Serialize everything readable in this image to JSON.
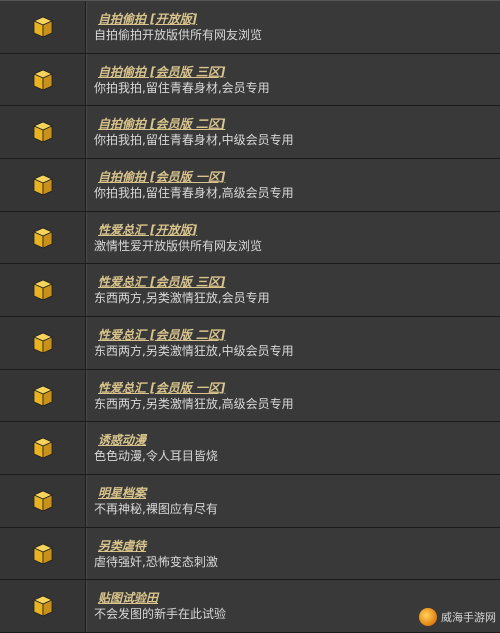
{
  "forums": [
    {
      "title": "自拍偷拍 [开放版]",
      "desc": "自拍偷拍开放版供所有网友浏览"
    },
    {
      "title": "自拍偷拍 [会员版 三区]",
      "desc": "你拍我拍,留住青春身材,会员专用"
    },
    {
      "title": "自拍偷拍 [会员版 二区]",
      "desc": "你拍我拍,留住青春身材,中级会员专用"
    },
    {
      "title": "自拍偷拍 [会员版 一区]",
      "desc": "你拍我拍,留住青春身材,高级会员专用"
    },
    {
      "title": "性爱总汇 [开放版]",
      "desc": "激情性爱开放版供所有网友浏览"
    },
    {
      "title": "性爱总汇 [会员版 三区]",
      "desc": "东西两方,另类激情狂放,会员专用"
    },
    {
      "title": "性爱总汇 [会员版 二区]",
      "desc": "东西两方,另类激情狂放,中级会员专用"
    },
    {
      "title": "性爱总汇 [会员版 一区]",
      "desc": "东西两方,另类激情狂放,高级会员专用"
    },
    {
      "title": "诱惑动漫",
      "desc": "色色动漫,令人耳目皆烧"
    },
    {
      "title": "明星档案",
      "desc": "不再神秘,裸图应有尽有"
    },
    {
      "title": "另类虐待",
      "desc": "虐待强奸,恐怖变态刺激"
    },
    {
      "title": "贴图试验田",
      "desc": "不会发图的新手在此试验"
    }
  ],
  "icon": "forum-cube-icon",
  "colors": {
    "title": "#d9c48c",
    "desc": "#d8d8d8",
    "cube": "#f2c230"
  },
  "watermark": "威海手游网"
}
